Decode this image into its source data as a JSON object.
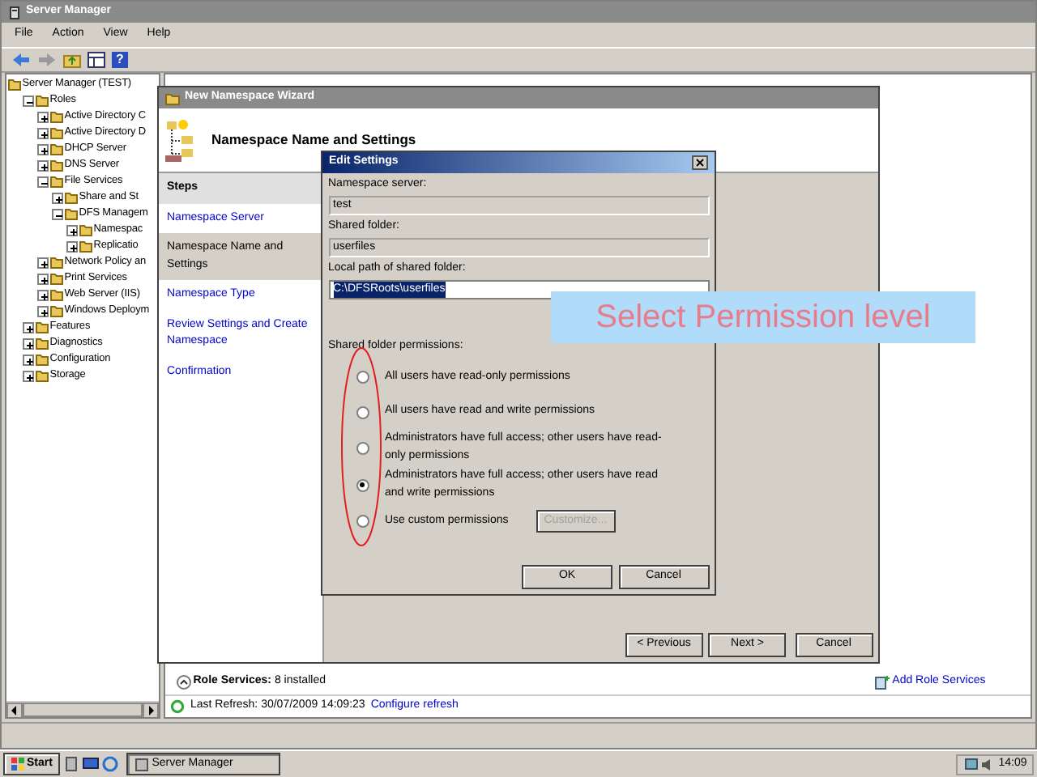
{
  "main_window": {
    "title": "Server Manager",
    "menu": [
      "File",
      "Action",
      "View",
      "Help"
    ],
    "help_button": "?",
    "tree": [
      {
        "label": "Server Manager (TEST)",
        "children": [
          {
            "label": "Roles",
            "expanded": true,
            "children": [
              {
                "label": "Active Directory C",
                "expanded": false
              },
              {
                "label": "Active Directory D",
                "expanded": false
              },
              {
                "label": "DHCP Server",
                "expanded": false
              },
              {
                "label": "DNS Server",
                "expanded": false
              },
              {
                "label": "File Services",
                "expanded": true,
                "children": [
                  {
                    "label": "Share and St",
                    "expanded": false
                  },
                  {
                    "label": "DFS Managem",
                    "expanded": true,
                    "children": [
                      {
                        "label": "Namespac",
                        "expanded": false
                      },
                      {
                        "label": "Replicatio",
                        "expanded": false
                      }
                    ]
                  }
                ]
              },
              {
                "label": "Network Policy an",
                "expanded": false
              },
              {
                "label": "Print Services",
                "expanded": false
              },
              {
                "label": "Web Server (IIS)",
                "expanded": false
              },
              {
                "label": "Windows Deploym",
                "expanded": false
              }
            ]
          },
          {
            "label": "Features",
            "expanded": false
          },
          {
            "label": "Diagnostics",
            "expanded": false
          },
          {
            "label": "Configuration",
            "expanded": false
          },
          {
            "label": "Storage",
            "expanded": false
          }
        ]
      }
    ],
    "role_services_label": "Role Services:",
    "role_services_value": "8 installed",
    "add_role_services": "Add Role Services",
    "last_refresh": "Last Refresh: 30/07/2009 14:09:23",
    "configure_refresh": "Configure refresh"
  },
  "wizard": {
    "title": "New Namespace Wizard",
    "heading": "Namespace Name and Settings",
    "steps_heading": "Steps",
    "steps": [
      {
        "label": "Namespace Server",
        "selected": false
      },
      {
        "label": "Namespace Name and Settings",
        "selected": true
      },
      {
        "label": "Namespace Type",
        "selected": false
      },
      {
        "label": "Review Settings and Create Namespace",
        "selected": false
      },
      {
        "label": "Confirmation",
        "selected": false
      }
    ],
    "buttons": [
      "< Previous",
      "Next >",
      "Cancel"
    ]
  },
  "dialog": {
    "title": "Edit Settings",
    "fields": [
      {
        "label": "Namespace server:",
        "value": "test",
        "read_only": true,
        "text_selected": false
      },
      {
        "label": "Shared folder:",
        "value": "userfiles",
        "read_only": true,
        "text_selected": false
      },
      {
        "label": "Local path of shared folder:",
        "value": "C:\\DFSRoots\\userfiles",
        "read_only": false,
        "text_selected": true
      }
    ],
    "permissions_label": "Shared folder permissions:",
    "options": [
      {
        "label": "All users have read-only permissions",
        "selected": false
      },
      {
        "label": "All users have read and write permissions",
        "selected": false
      },
      {
        "label": "Administrators have full access; other users have read-only permissions",
        "selected": false
      },
      {
        "label": "Administrators have full access; other users have read and write permissions",
        "selected": true
      },
      {
        "label": "Use custom permissions",
        "selected": false
      }
    ],
    "customize": {
      "label": "Customize...",
      "disabled": true
    },
    "buttons": [
      "OK",
      "Cancel"
    ]
  },
  "annotation": {
    "text": "Select Permission level"
  },
  "taskbar": {
    "start": "Start",
    "tasks": [
      "Server Manager"
    ],
    "clock": "14:09"
  }
}
